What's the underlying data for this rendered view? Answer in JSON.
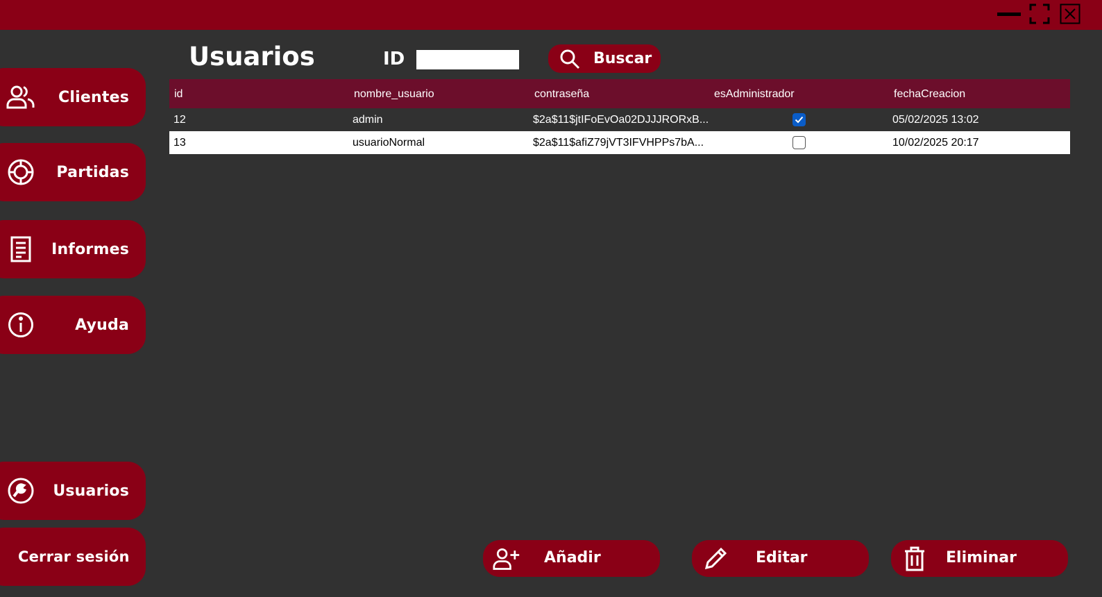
{
  "window": {
    "controls": [
      "minimize-icon",
      "maximize-icon",
      "close-icon"
    ],
    "accent_color": "#8a0016",
    "header_color": "#6c0e2b",
    "background_color": "#313131"
  },
  "sidebar": {
    "items": [
      {
        "label": "Clientes",
        "icon": "users-icon"
      },
      {
        "label": "Partidas",
        "icon": "game-icon"
      },
      {
        "label": "Informes",
        "icon": "document-icon"
      },
      {
        "label": "Ayuda",
        "icon": "info-icon"
      },
      {
        "label": "Usuarios",
        "icon": "wrench-icon"
      },
      {
        "label": "Cerrar sesión"
      }
    ]
  },
  "header": {
    "title": "Usuarios",
    "id_label": "ID",
    "id_value": "",
    "search_label": "Buscar"
  },
  "grid": {
    "columns": [
      "id",
      "nombre_usuario",
      "contraseña",
      "esAdministrador",
      "fechaCreacion"
    ],
    "rows": [
      {
        "id": "12",
        "nombre_usuario": "admin",
        "contrasena": "$2a$11$jtIFoEvOa02DJJJRORxB...",
        "esAdministrador": true,
        "fechaCreacion": "05/02/2025 13:02"
      },
      {
        "id": "13",
        "nombre_usuario": "usuarioNormal",
        "contrasena": "$2a$11$afiZ79jVT3IFVHPPs7bA...",
        "esAdministrador": false,
        "fechaCreacion": "10/02/2025 20:17"
      }
    ]
  },
  "actions": {
    "add_label": "Añadir",
    "edit_label": "Editar",
    "delete_label": "Eliminar"
  }
}
